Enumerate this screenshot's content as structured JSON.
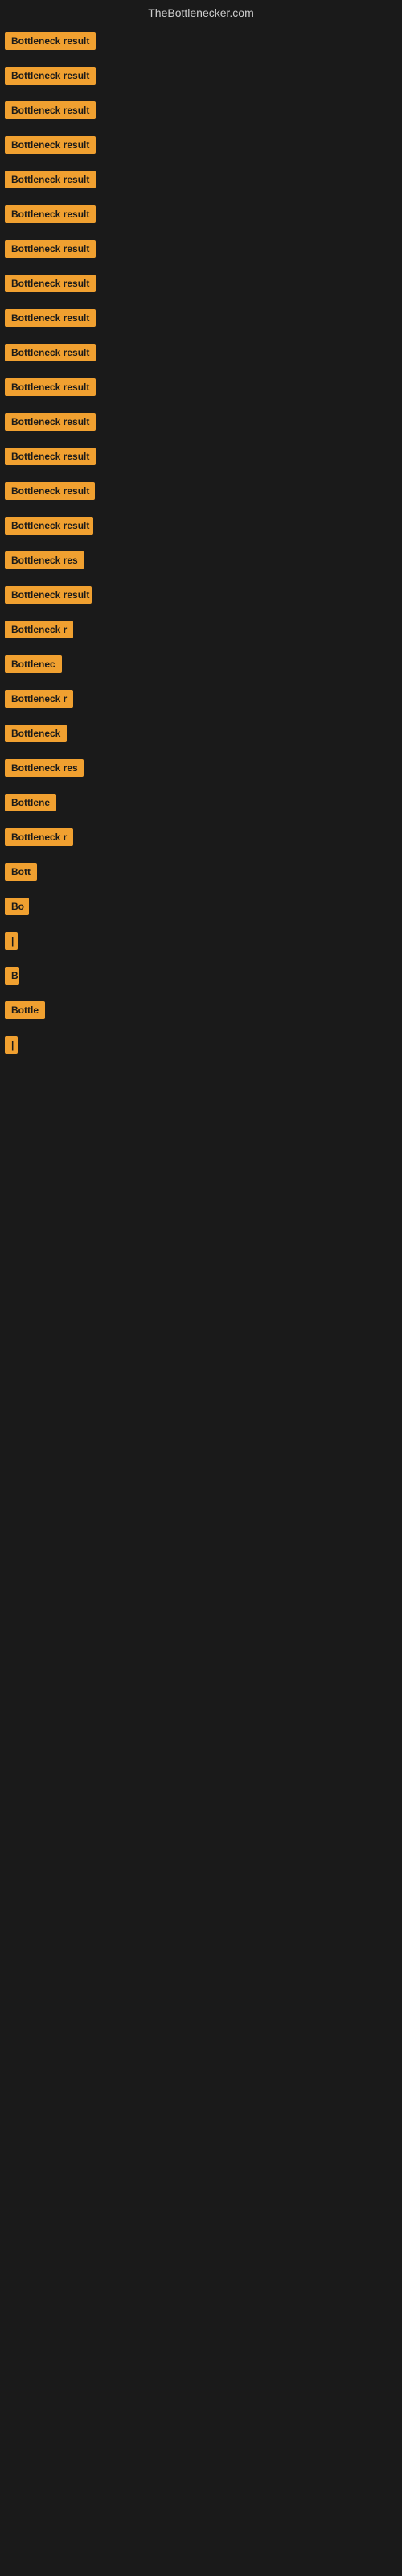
{
  "site": {
    "title": "TheBottlenecker.com"
  },
  "items": [
    {
      "label": "Bottleneck result",
      "width": 130
    },
    {
      "label": "Bottleneck result",
      "width": 130
    },
    {
      "label": "Bottleneck result",
      "width": 128
    },
    {
      "label": "Bottleneck result",
      "width": 126
    },
    {
      "label": "Bottleneck result",
      "width": 130
    },
    {
      "label": "Bottleneck result",
      "width": 128
    },
    {
      "label": "Bottleneck result",
      "width": 126
    },
    {
      "label": "Bottleneck result",
      "width": 124
    },
    {
      "label": "Bottleneck result",
      "width": 122
    },
    {
      "label": "Bottleneck result",
      "width": 120
    },
    {
      "label": "Bottleneck result",
      "width": 118
    },
    {
      "label": "Bottleneck result",
      "width": 116
    },
    {
      "label": "Bottleneck result",
      "width": 114
    },
    {
      "label": "Bottleneck result",
      "width": 112
    },
    {
      "label": "Bottleneck result",
      "width": 110
    },
    {
      "label": "Bottleneck res",
      "width": 100
    },
    {
      "label": "Bottleneck result",
      "width": 108
    },
    {
      "label": "Bottleneck r",
      "width": 90
    },
    {
      "label": "Bottlenec",
      "width": 76
    },
    {
      "label": "Bottleneck r",
      "width": 88
    },
    {
      "label": "Bottleneck",
      "width": 80
    },
    {
      "label": "Bottleneck res",
      "width": 98
    },
    {
      "label": "Bottlene",
      "width": 70
    },
    {
      "label": "Bottleneck r",
      "width": 86
    },
    {
      "label": "Bott",
      "width": 46
    },
    {
      "label": "Bo",
      "width": 30
    },
    {
      "label": "|",
      "width": 12
    },
    {
      "label": "B",
      "width": 18
    },
    {
      "label": "Bottle",
      "width": 55
    },
    {
      "label": "|",
      "width": 12
    }
  ]
}
